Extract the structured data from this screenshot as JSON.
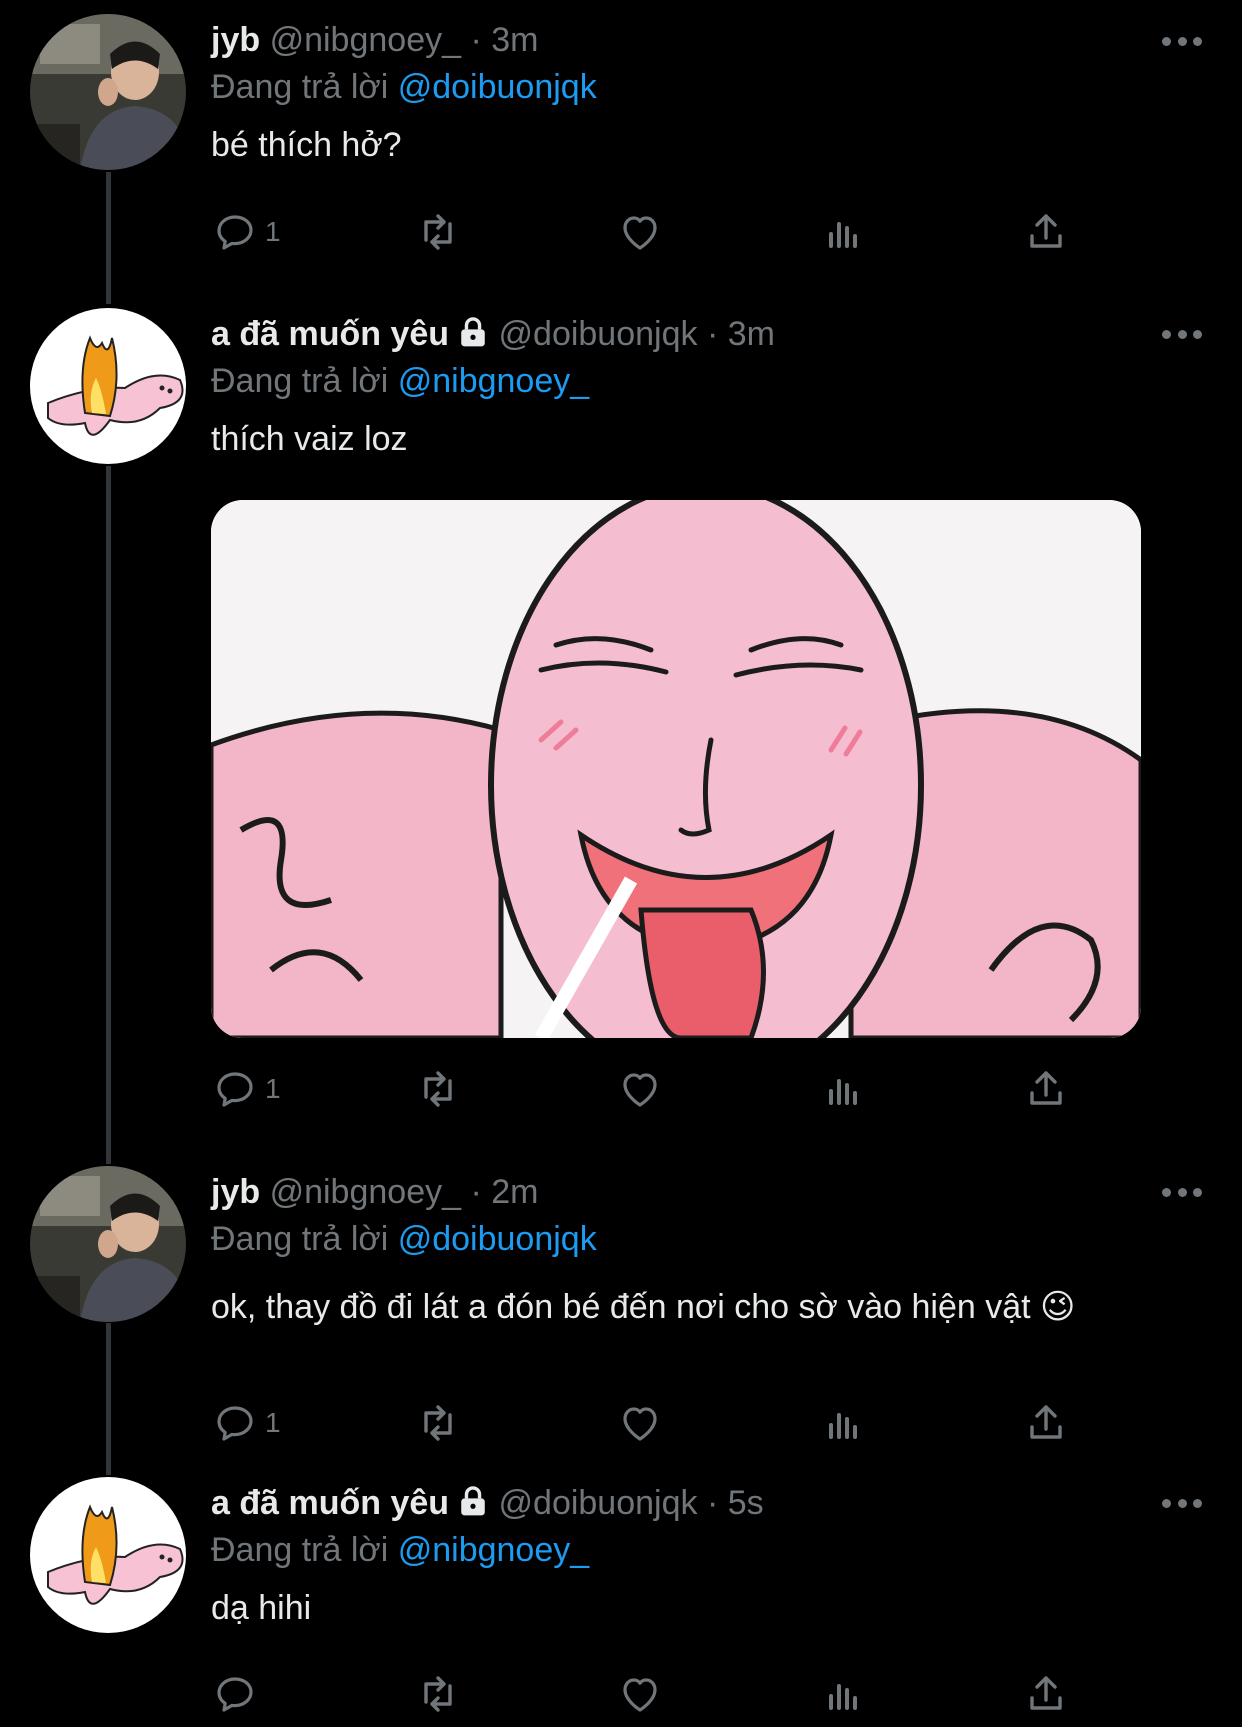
{
  "tweets": [
    {
      "name": "jyb",
      "handle": "@nibgnoey_",
      "time": "· 3m",
      "replying_prefix": "Đang trả lời",
      "replying_to": "@doibuonjqk",
      "text": "bé thích hở?",
      "reply_count": "1",
      "avatar_icon": "profile-photo-man-in-car",
      "locked": false
    },
    {
      "name": "a đã muốn yêu",
      "handle": "@doibuonjqk",
      "time": "· 3m",
      "replying_prefix": "Đang trả lời",
      "replying_to": "@nibgnoey_",
      "text": "thích vaiz loz",
      "reply_count": "1",
      "avatar_icon": "cartoon-pink-rabbit-with-flame",
      "locked": true,
      "media_icon": "pink-cartoon-blob-licking-face"
    },
    {
      "name": "jyb",
      "handle": "@nibgnoey_",
      "time": "· 2m",
      "replying_prefix": "Đang trả lời",
      "replying_to": "@doibuonjqk",
      "text": "ok, thay đồ đi lát a đón bé đến nơi cho sờ vào hiện vật",
      "emoji": "😉",
      "reply_count": "1",
      "avatar_icon": "profile-photo-man-in-car",
      "locked": false
    },
    {
      "name": "a đã muốn yêu",
      "handle": "@doibuonjqk",
      "time": "· 5s",
      "replying_prefix": "Đang trả lời",
      "replying_to": "@nibgnoey_",
      "text": "dạ hihi",
      "reply_count": "",
      "avatar_icon": "cartoon-pink-rabbit-with-flame",
      "locked": true
    }
  ],
  "colors": {
    "background": "#000000",
    "text": "#e7e9ea",
    "secondary": "#71767b",
    "link": "#1d9bf0",
    "thread_line": "#333639"
  }
}
